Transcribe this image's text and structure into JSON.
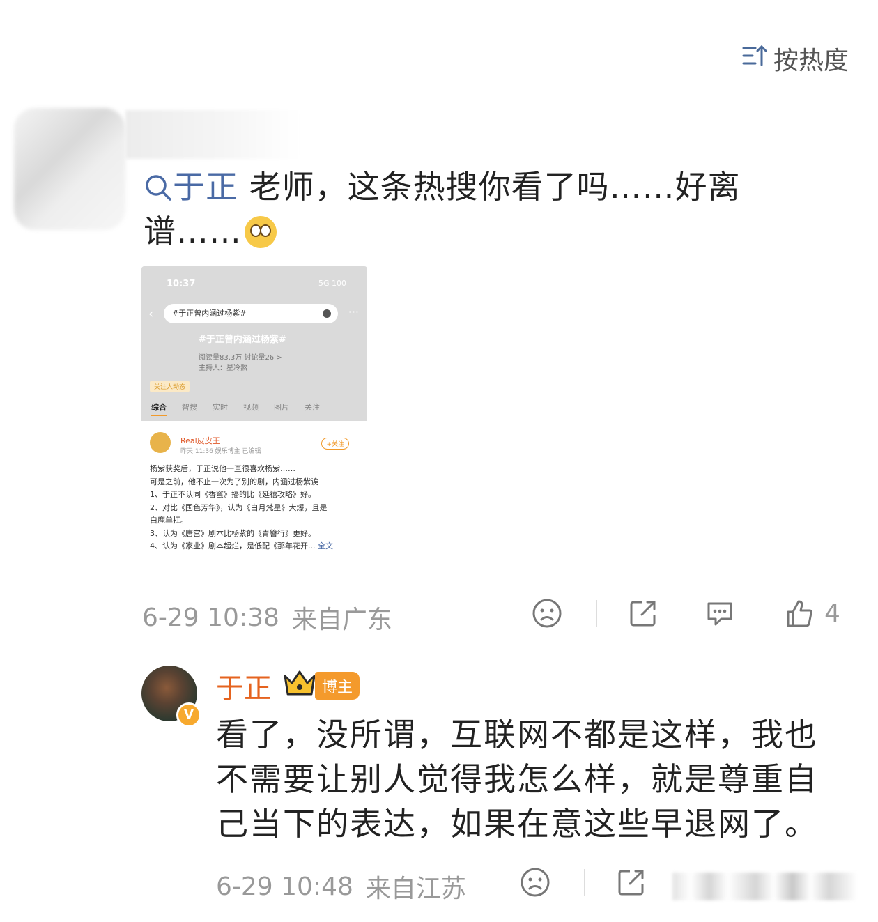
{
  "sort": {
    "label": "按热度"
  },
  "comment": {
    "mention": "于正",
    "text": " 老师，这条热搜你看了吗……好离谱……",
    "date": "6-29 10:38",
    "location": "来自广东",
    "like_count": "4"
  },
  "screenshot": {
    "time": "10:37",
    "status": "5G 100",
    "search_text": "#于正曾内涵过杨紫#",
    "banner": "#于正曾内涵过杨紫#",
    "stats_line1": "阅读量83.3万  讨论量26  >",
    "stats_line2": "主持人：星冷熬",
    "follow_tag": "关注人动态",
    "tabs": [
      "综合",
      "智搜",
      "实时",
      "视频",
      "图片",
      "关注"
    ],
    "post": {
      "user": "Real皮皮王",
      "meta": "昨天 11:36  娱乐博主 已编辑",
      "follow": "+关注",
      "lines": [
        "杨紫获奖后，于正说他一直很喜欢杨紫……",
        "可是之前，他不止一次为了别的剧，内涵过杨紫诶",
        "1、于正不认同《香蜜》播的比《延禧攻略》好。",
        "2、对比《国色芳华》，认为《白月梵星》大爆，且是",
        "白鹿单扛。",
        "3、认为《唐宫》剧本比杨紫的《青簪行》更好。",
        "4、认为《家业》剧本超烂，是低配《那年花开..."
      ],
      "full": "全文"
    }
  },
  "reply": {
    "name": "于正",
    "badge": "博主",
    "text": "看了，没所谓，互联网不都是这样，我也不需要让别人觉得我怎么样，就是尊重自己当下的表达，如果在意这些早退网了。",
    "date": "6-29 10:48",
    "location": "来自江苏"
  }
}
